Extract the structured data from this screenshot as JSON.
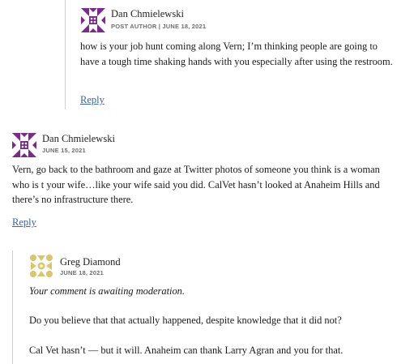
{
  "comments": [
    {
      "author": "Dan Chmielewski",
      "meta": "POST AUTHOR | JUNE 18, 2021",
      "body": "how is your job hunt coming along Vern; I’m thinking people are going to have a tough time shaking hands with you especially after using the restroom.",
      "reply": "Reply",
      "avatar_icon": "purple-quilt-avatar-icon"
    },
    {
      "author": "Dan Chmielewski",
      "meta": "JUNE 15, 2021",
      "body": "Vern, go back to the bathroom and gaze at Twitter photos of someone you think is a woman who is t your wife…like your wife said you did. CalVet hasn’t looked at Anaheim Hills and there’s no infrastructure there.",
      "reply": "Reply",
      "avatar_icon": "purple-quilt-avatar-icon"
    },
    {
      "author": "Greg Diamond",
      "meta": "JUNE 18, 2021",
      "moderation": "Your comment is awaiting moderation.",
      "paragraphs": [
        "Do you believe that that actually happened, despite knowledge that it did not?",
        "Cal Vet hasn’t — but it will. Anaheim can thank Larry Agran and you for that."
      ],
      "avatar_icon": "gold-quilt-avatar-icon"
    }
  ],
  "colors": {
    "link": "#3b63a8",
    "purple_avatar": "#7b2a8c",
    "gold_avatar": "#d9c66a",
    "thread_line": "#cfcfcf"
  }
}
